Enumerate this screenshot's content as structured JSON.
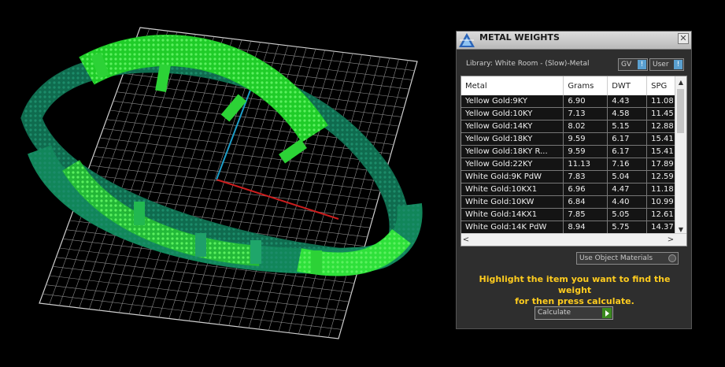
{
  "panel": {
    "title": "METAL WEIGHTS",
    "close_glyph": "✕",
    "library_label": "Library: White Room - (Slow)-Metal",
    "gv_label": "GV",
    "user_label": "User",
    "toggle_indicator": "!",
    "table": {
      "columns": [
        "Metal",
        "Grams",
        "DWT",
        "SPG"
      ],
      "rows": [
        [
          "Yellow Gold:9KY",
          "6.90",
          "4.43",
          "11.08"
        ],
        [
          "Yellow Gold:10KY",
          "7.13",
          "4.58",
          "11.45"
        ],
        [
          "Yellow Gold:14KY",
          "8.02",
          "5.15",
          "12.88"
        ],
        [
          "Yellow Gold:18KY",
          "9.59",
          "6.17",
          "15.41"
        ],
        [
          "Yellow Gold:18KY R...",
          "9.59",
          "6.17",
          "15.41"
        ],
        [
          "Yellow Gold:22KY",
          "11.13",
          "7.16",
          "17.89"
        ],
        [
          "White Gold:9K PdW",
          "7.83",
          "5.04",
          "12.59"
        ],
        [
          "White Gold:10KX1",
          "6.96",
          "4.47",
          "11.18"
        ],
        [
          "White Gold:10KW",
          "6.84",
          "4.40",
          "10.99"
        ],
        [
          "White Gold:14KX1",
          "7.85",
          "5.05",
          "12.61"
        ],
        [
          "White Gold:14K PdW",
          "8.94",
          "5.75",
          "14.37"
        ]
      ]
    },
    "scroll_up": "▲",
    "scroll_down": "▼",
    "scroll_left": "<",
    "scroll_right": ">",
    "use_object_materials": "Use Object Materials",
    "help_text_line1": "Highlight the item you want to find the weight",
    "help_text_line2": "for then press calculate.",
    "calculate_label": "Calculate"
  },
  "colors": {
    "grid": "#bfbfbf",
    "axis_x": "#cc1e1e",
    "axis_y": "#1e9ec8",
    "bright_green": "#22d32a",
    "dark_green": "#0f6b4e",
    "help_text": "#ffcc1e"
  },
  "icons": [
    "app-logo-icon",
    "close-icon",
    "play-icon"
  ]
}
